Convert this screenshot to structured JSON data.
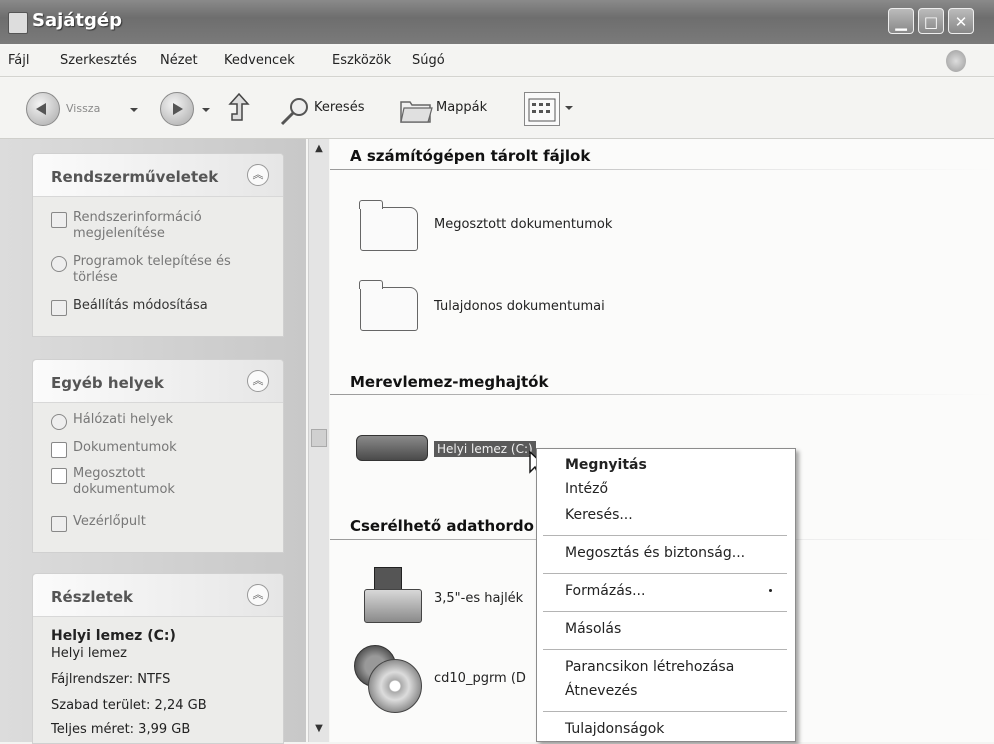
{
  "window": {
    "title": "Sajátgép",
    "buttons": [
      "minimize",
      "maximize",
      "close"
    ]
  },
  "menubar": {
    "items": [
      "Fájl",
      "Szerkesztés",
      "Nézet",
      "Kedvencek",
      "Eszközök",
      "Súgó"
    ]
  },
  "toolbar": {
    "back_label": "Vissza",
    "search_label": "Keresés",
    "folders_label": "Mappák"
  },
  "sidebar": {
    "system_tasks": {
      "title": "Rendszerműveletek",
      "items": [
        {
          "label": "Rendszerinformáció megjelenítése",
          "icon": "info-icon"
        },
        {
          "label": "Programok telepítése és törlése",
          "icon": "install-icon"
        },
        {
          "label": "Beállítás módosítása",
          "icon": "control-icon"
        }
      ]
    },
    "other_places": {
      "title": "Egyéb helyek",
      "items": [
        {
          "label": "Hálózati helyek",
          "icon": "network-icon"
        },
        {
          "label": "Dokumentumok",
          "icon": "folder-icon"
        },
        {
          "label": "Megosztott dokumentumok",
          "icon": "folder-icon"
        },
        {
          "label": "Vezérlőpult",
          "icon": "control-panel-icon"
        }
      ]
    },
    "details": {
      "title": "Részletek",
      "name": "Helyi lemez (C:)",
      "type": "Helyi lemez",
      "filesystem": "Fájlrendszer: NTFS",
      "free": "Szabad terület: 2,24 GB",
      "total": "Teljes méret: 3,99 GB"
    }
  },
  "main": {
    "section_files": "A számítógépen tárolt fájlok",
    "folders": [
      "Megosztott dokumentumok",
      "Tulajdonos dokumentumai"
    ],
    "section_drives": "Merevlemez-meghajtók",
    "drive_label": "Helyi lemez (C:)",
    "section_removable": "Cserélhető adathordo",
    "removable": [
      "3,5\"-es hajlék",
      "cd10_pgrm (D"
    ]
  },
  "context_menu": {
    "items": [
      {
        "label": "Megnyitás",
        "bold": true
      },
      {
        "label": "Intéző"
      },
      {
        "label": "Keresés..."
      },
      {
        "label": "Megosztás és biztonság..."
      },
      {
        "label": "Formázás..."
      },
      {
        "label": "Másolás"
      },
      {
        "label": "Parancsikon létrehozása"
      },
      {
        "label": "Átnevezés"
      },
      {
        "label": "Tulajdonságok"
      }
    ]
  }
}
